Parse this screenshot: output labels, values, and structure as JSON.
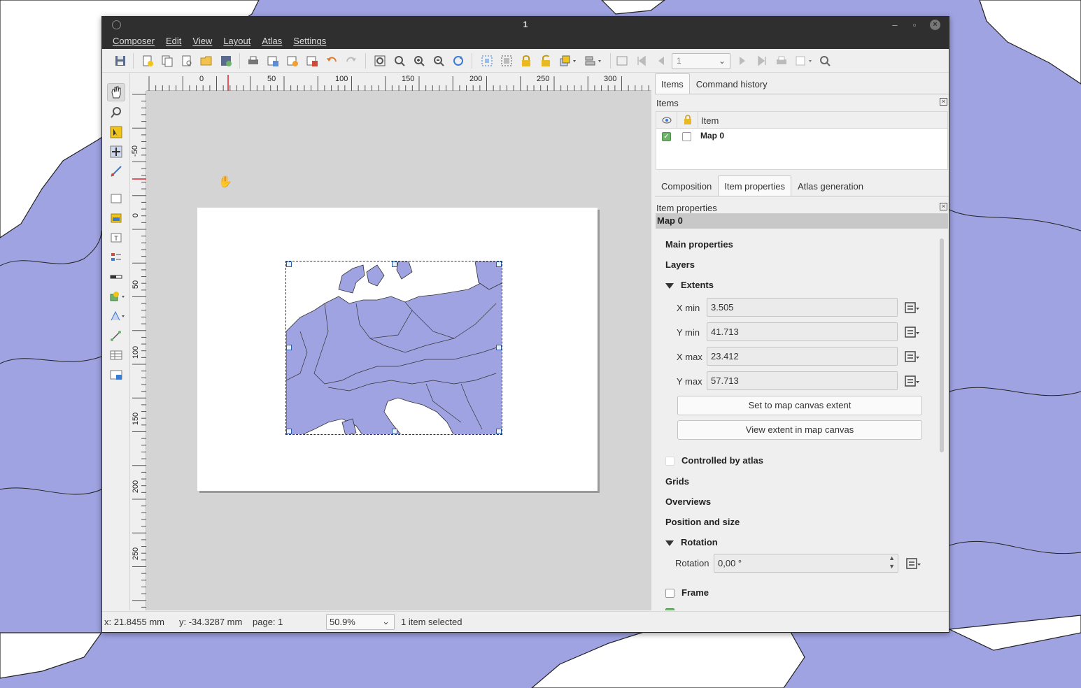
{
  "window": {
    "title": "1"
  },
  "menu": [
    "Composer",
    "Edit",
    "View",
    "Layout",
    "Atlas",
    "Settings"
  ],
  "toolbar": {
    "page_value": "1"
  },
  "ruler": {
    "h_labels": [
      "0",
      "50",
      "100",
      "150",
      "200",
      "250",
      "300"
    ],
    "v_labels": [
      "-50",
      "0",
      "50",
      "100",
      "150",
      "200",
      "250"
    ]
  },
  "top_tabs": [
    "Items",
    "Command history"
  ],
  "items_panel": {
    "title": "Items",
    "column_item": "Item",
    "rows": [
      {
        "name": "Map 0",
        "visible": true,
        "locked": false
      }
    ]
  },
  "bottom_tabs": [
    "Composition",
    "Item properties",
    "Atlas generation"
  ],
  "item_properties": {
    "title": "Item properties",
    "item_name": "Map 0",
    "sections": {
      "main": "Main properties",
      "layers": "Layers",
      "extents": "Extents",
      "controlled": "Controlled by atlas",
      "grids": "Grids",
      "overviews": "Overviews",
      "position": "Position and size",
      "rotation": "Rotation",
      "frame": "Frame"
    },
    "extents": {
      "xmin_label": "X min",
      "xmin": "3.505",
      "ymin_label": "Y min",
      "ymin": "41.713",
      "xmax_label": "X max",
      "xmax": "23.412",
      "ymax_label": "Y max",
      "ymax": "57.713"
    },
    "buttons": {
      "set_extent": "Set to map canvas extent",
      "view_extent": "View extent in map canvas"
    },
    "rotation_label": "Rotation",
    "rotation_value": "0,00 °"
  },
  "status": {
    "x": "x: 21.8455 mm",
    "y": "y: -34.3287 mm",
    "page": "page: 1",
    "zoom": "50.9%",
    "selection": "1 item selected"
  },
  "colors": {
    "land": "#9fa3e2",
    "titlebar": "#2f2f2f",
    "check": "#6db36a"
  }
}
